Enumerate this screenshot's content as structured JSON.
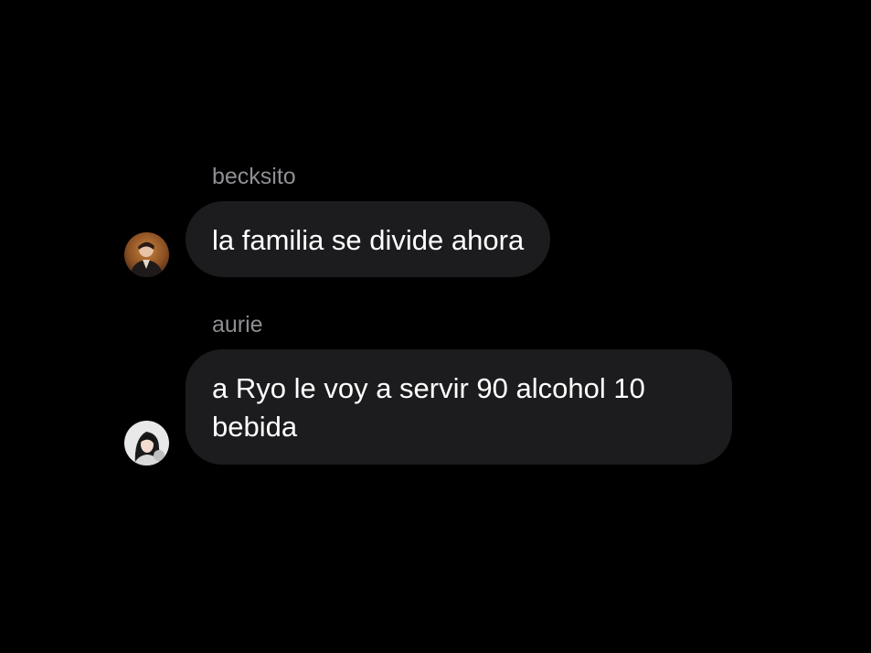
{
  "messages": [
    {
      "sender": "becksito",
      "text": "la familia se divide ahora",
      "avatar_icon": "user-avatar-photo-icon"
    },
    {
      "sender": "aurie",
      "text": "a Ryo le voy a servir 90 alcohol 10 bebida",
      "avatar_icon": "user-avatar-photo-icon"
    }
  ],
  "colors": {
    "background": "#000000",
    "bubble": "#1c1c1e",
    "sender_name": "#8e8e93",
    "message_text": "#ffffff"
  }
}
